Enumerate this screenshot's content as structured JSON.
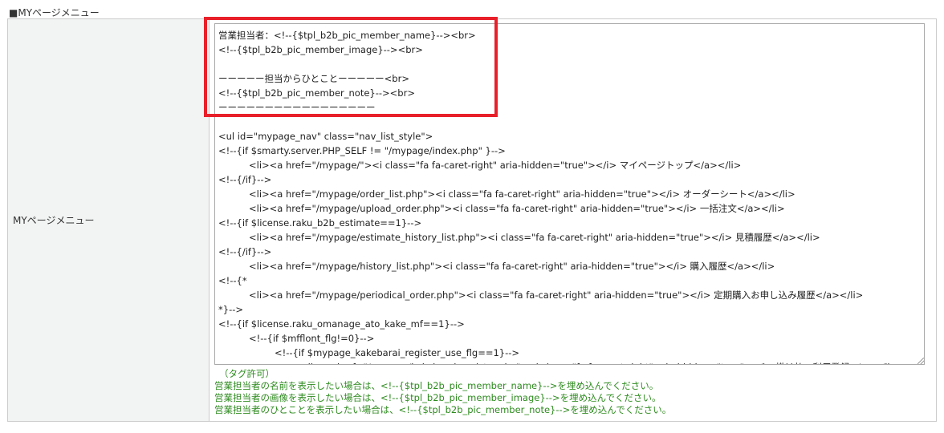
{
  "section_title": "■MYページメニュー",
  "row_label": "MYページメニュー",
  "textarea_lines": [
    {
      "indent": 0,
      "text": "営業担当者：<!--{$tpl_b2b_pic_member_name}--><br>"
    },
    {
      "indent": 0,
      "text": "<!--{$tpl_b2b_pic_member_image}--><br>"
    },
    {
      "indent": 0,
      "text": ""
    },
    {
      "indent": 0,
      "text": "ーーーーー担当からひとことーーーーー<br>"
    },
    {
      "indent": 0,
      "text": "<!--{$tpl_b2b_pic_member_note}--><br>"
    },
    {
      "indent": 0,
      "text": "ーーーーーーーーーーーーーーーーー"
    },
    {
      "indent": 0,
      "text": ""
    },
    {
      "indent": 0,
      "text": "<ul id=\"mypage_nav\" class=\"nav_list_style\">"
    },
    {
      "indent": 0,
      "text": "<!--{if $smarty.server.PHP_SELF != \"/mypage/index.php\" }-->"
    },
    {
      "indent": 1,
      "text": "<li><a href=\"/mypage/\"><i class=\"fa fa-caret-right\" aria-hidden=\"true\"></i> マイページトップ</a></li>"
    },
    {
      "indent": 0,
      "text": "<!--{/if}-->"
    },
    {
      "indent": 1,
      "text": "<li><a href=\"/mypage/order_list.php\"><i class=\"fa fa-caret-right\" aria-hidden=\"true\"></i> オーダーシート</a></li>"
    },
    {
      "indent": 1,
      "text": "<li><a href=\"/mypage/upload_order.php\"><i class=\"fa fa-caret-right\" aria-hidden=\"true\"></i> 一括注文</a></li>"
    },
    {
      "indent": 0,
      "text": "<!--{if $license.raku_b2b_estimate==1}-->"
    },
    {
      "indent": 1,
      "text": "<li><a href=\"/mypage/estimate_history_list.php\"><i class=\"fa fa-caret-right\" aria-hidden=\"true\"></i> 見積履歴</a></li>"
    },
    {
      "indent": 0,
      "text": "<!--{/if}-->"
    },
    {
      "indent": 1,
      "text": "<li><a href=\"/mypage/history_list.php\"><i class=\"fa fa-caret-right\" aria-hidden=\"true\"></i> 購入履歴</a></li>"
    },
    {
      "indent": 0,
      "text": "<!--{*"
    },
    {
      "indent": 1,
      "text": "<li><a href=\"/mypage/periodical_order.php\"><i class=\"fa fa-caret-right\" aria-hidden=\"true\"></i> 定期購入お申し込み履歴</a></li>"
    },
    {
      "indent": 0,
      "text": "*}-->"
    },
    {
      "indent": 0,
      "text": "<!--{if $license.raku_omanage_ato_kake_mf==1}-->"
    },
    {
      "indent": 1,
      "text": "<!--{if $mfflont_flg!=0}-->"
    },
    {
      "indent": 2,
      "text": "<!--{if $mypage_kakebarai_register_use_flg==1}-->"
    },
    {
      "indent": 3,
      "text": "<li><a href=\"/mypage/kakebarai_register.php\"><i class=\"fa fa-caret-right\" aria-hidden=\"true\"></i> 掛け払い利用登録</a></li>"
    }
  ],
  "notes": {
    "tag_allowed": "（タグ許可）",
    "lines": [
      "営業担当者の名前を表示したい場合は、<!--{$tpl_b2b_pic_member_name}-->を埋め込んでください。",
      "営業担当者の画像を表示したい場合は、<!--{$tpl_b2b_pic_member_image}-->を埋め込んでください。",
      "営業担当者のひとことを表示したい場合は、<!--{$tpl_b2b_pic_member_note}-->を埋め込んでください。"
    ]
  },
  "colors": {
    "highlight": "#e8202a",
    "note_text": "#2e8b1f",
    "label_bg": "#f2f3f3"
  }
}
